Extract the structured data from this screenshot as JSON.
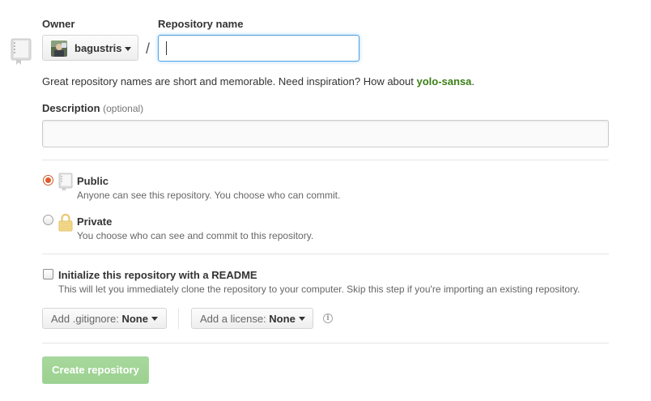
{
  "owner": {
    "label": "Owner",
    "username": "bagustris"
  },
  "repo_name": {
    "label": "Repository name",
    "separator": "/",
    "value": ""
  },
  "hint": {
    "text": "Great repository names are short and memorable. Need inspiration? How about ",
    "suggestion": "yolo-sansa",
    "suffix": "."
  },
  "description": {
    "label": "Description",
    "optional": "(optional)",
    "value": ""
  },
  "visibility": {
    "selected": "public",
    "public": {
      "title": "Public",
      "desc": "Anyone can see this repository. You choose who can commit."
    },
    "private": {
      "title": "Private",
      "desc": "You choose who can see and commit to this repository."
    }
  },
  "readme": {
    "title": "Initialize this repository with a README",
    "desc": "This will let you immediately clone the repository to your computer. Skip this step if you're importing an existing repository.",
    "checked": false
  },
  "gitignore": {
    "label": "Add .gitignore:",
    "value": "None"
  },
  "license": {
    "label": "Add a license:",
    "value": "None"
  },
  "info_glyph": "i",
  "create_button": {
    "label": "Create repository",
    "disabled": true
  },
  "colors": {
    "accent_green": "#3a7f14",
    "radio_checked": "#e05a2b",
    "focus_blue": "#51a7e8",
    "create_button_disabled": "#9bd191"
  },
  "icons": {
    "repo": "repo-icon",
    "lock": "lock-icon",
    "info": "info-icon",
    "caret": "caret-down-icon"
  }
}
